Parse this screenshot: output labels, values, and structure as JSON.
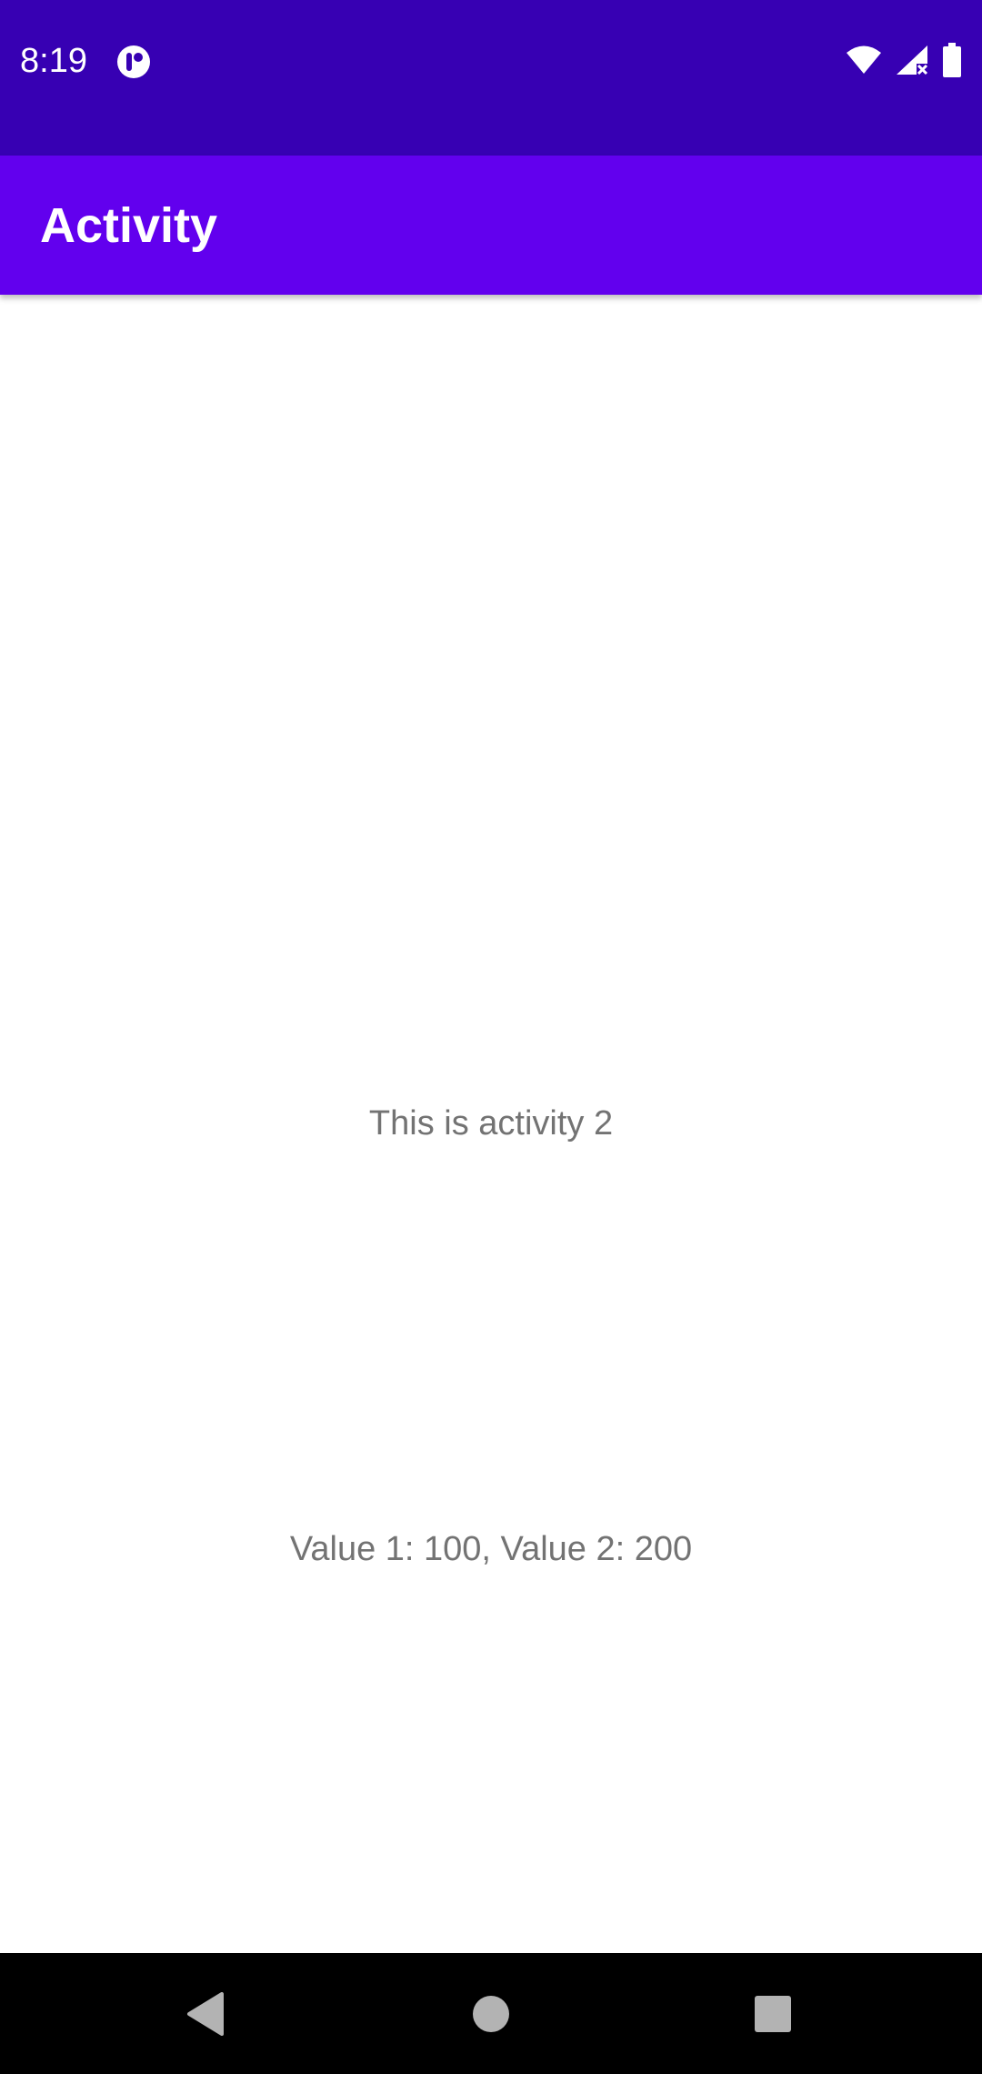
{
  "status_bar": {
    "time": "8:19",
    "notification_icon": "app-notification-icon",
    "icons": [
      "wifi-icon",
      "signal-icon",
      "battery-icon"
    ],
    "background": "#3700b3"
  },
  "app_bar": {
    "title": "Activity",
    "background": "#6200ee"
  },
  "content": {
    "message": "This is activity 2",
    "values_text": "Value 1: 100, Value 2: 200"
  },
  "nav_bar": {
    "buttons": [
      "back-icon",
      "home-icon",
      "recents-icon"
    ]
  }
}
